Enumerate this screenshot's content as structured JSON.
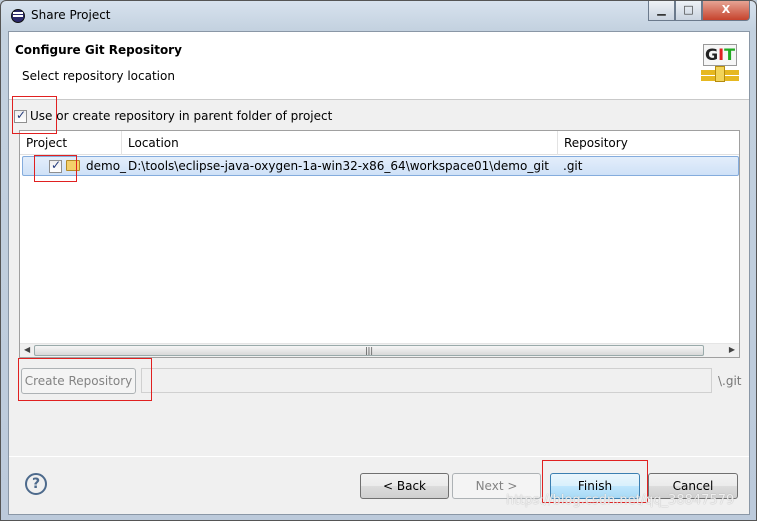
{
  "window": {
    "title": "Share Project",
    "minimize": "▁",
    "maximize": "□",
    "close": "X"
  },
  "header": {
    "title": "Configure Git Repository",
    "subtitle": "Select repository location",
    "logo_text": "GIT"
  },
  "option": {
    "label": "Use or create repository in parent folder of project",
    "checked": true
  },
  "table": {
    "columns": [
      "Project",
      "Location",
      "Repository"
    ],
    "rows": [
      {
        "project": "demo_",
        "location": "D:\\tools\\eclipse-java-oxygen-1a-win32-x86_64\\workspace01\\demo_git",
        "repository": ".git",
        "checked": true,
        "selected": true
      }
    ]
  },
  "create": {
    "button": "Create Repository",
    "path_value": "",
    "suffix": "\\.git"
  },
  "footer": {
    "back": "< Back",
    "next": "Next >",
    "finish": "Finish",
    "cancel": "Cancel",
    "help": "?"
  },
  "watermark": "https://blog.csdn.net/qq_38847579"
}
